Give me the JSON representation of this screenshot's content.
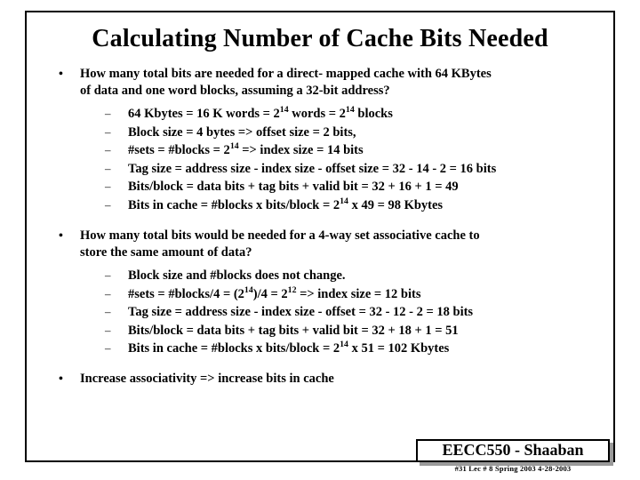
{
  "slide": {
    "title": "Calculating Number of Cache Bits Needed",
    "bullets": [
      {
        "marker": "•",
        "lines": [
          "How many total bits are needed for a direct- mapped cache with 64 KBytes",
          "of data and one word blocks, assuming a 32-bit address?"
        ],
        "sub_marker": "–",
        "sub_items": [
          "64 Kbytes  = 16 K words =  2<sup>14</sup> words =  2<sup>14</sup> blocks",
          "Block size  = 4 bytes => offset size =  2 bits,",
          "#sets  =  #blocks = 2<sup>14</sup>  => index size = 14 bits",
          "Tag size =  address size  -  index size - offset size  =  32 - 14 - 2  = 16 bits",
          "Bits/block =  data bits +  tag bits  +  valid bit  = 32 + 16 + 1 = 49",
          "Bits in cache =  #blocks  x  bits/block  =  2<sup>14</sup>  x  49 =  98 Kbytes"
        ]
      },
      {
        "marker": "•",
        "lines": [
          "How many total bits would be needed for a 4-way set associative cache to",
          "store the same amount of data?"
        ],
        "sub_marker": "–",
        "sub_items": [
          "Block size and  #blocks does not change.",
          "#sets = #blocks/4 = (2<sup>14</sup>)/4  =  2<sup>12</sup>  =>    index size = 12 bits",
          "Tag size =  address size - index size  -  offset = 32 - 12 - 2 = 18 bits",
          "Bits/block  =  data bits  + tag bits +  valid bit  = 32 + 18 + 1 = 51",
          "Bits in cache  =  #blocks  x  bits/block =  2<sup>14</sup>  x  51  =   102 Kbytes"
        ]
      },
      {
        "marker": "•",
        "lines": [
          "Increase associativity  =>  increase bits in cache"
        ],
        "sub_marker": "–",
        "sub_items": []
      }
    ],
    "footer": {
      "label": "EECC550 - Shaaban",
      "meta": "#31   Lec # 8   Spring 2003   4-28-2003"
    }
  }
}
